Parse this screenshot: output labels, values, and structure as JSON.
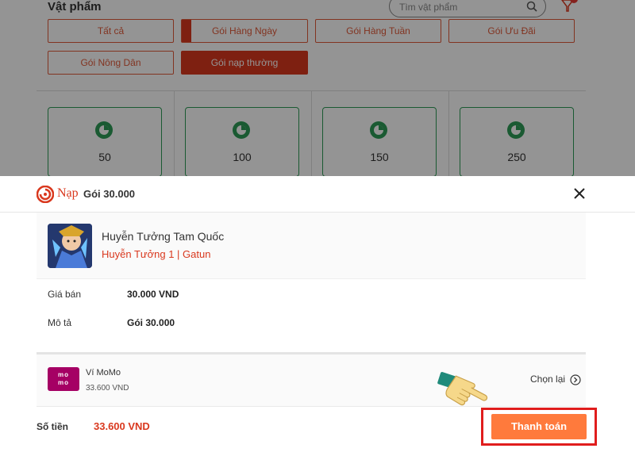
{
  "background": {
    "title": "Vật phẩm",
    "search_placeholder": "Tìm vật phẩm",
    "tabs": [
      {
        "label": "Tất cả"
      },
      {
        "label": "Gói Hàng Ngày"
      },
      {
        "label": "Gói Hàng Tuần"
      },
      {
        "label": "Gói Ưu Đãi"
      },
      {
        "label": "Gói Nông Dân"
      },
      {
        "label": "Gói nạp thường"
      }
    ],
    "active_tab": "Gói nạp thường",
    "cards": [
      {
        "value": "50"
      },
      {
        "value": "100"
      },
      {
        "value": "150"
      },
      {
        "value": "250"
      }
    ]
  },
  "sheet": {
    "brand": "Nạp",
    "title": "Gói 30.000",
    "game": {
      "name": "Huyễn Tưởng Tam Quốc",
      "server": "Huyễn Tưởng 1 | Gatun"
    },
    "info": [
      {
        "label": "Giá bán",
        "value": "30.000 VND"
      },
      {
        "label": "Mô tả",
        "value": "Gói 30.000"
      }
    ],
    "payment": {
      "logo_text_1": "mo",
      "logo_text_2": "mo",
      "name": "Ví MoMo",
      "amount": "33.600 VND",
      "change_label": "Chọn lại"
    },
    "total_label": "Số tiền",
    "total_value": "33.600 VND",
    "pay_button": "Thanh toán"
  },
  "colors": {
    "accent": "#d9381e",
    "pay_button": "#ff7a3c",
    "highlight_frame": "#e01d1d",
    "momo": "#a50064",
    "coin": "#2e9b56"
  }
}
